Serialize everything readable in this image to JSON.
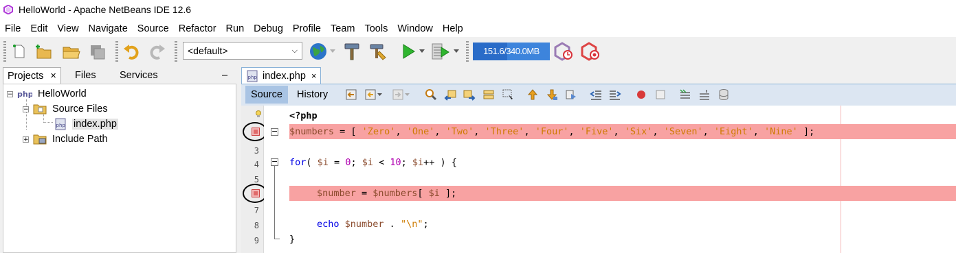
{
  "window": {
    "title": "HelloWorld - Apache NetBeans IDE 12.6"
  },
  "menu": [
    "File",
    "Edit",
    "View",
    "Navigate",
    "Source",
    "Refactor",
    "Run",
    "Debug",
    "Profile",
    "Team",
    "Tools",
    "Window",
    "Help"
  ],
  "toolbar": {
    "config_value": "<default>",
    "memory_label": "151.6/340.0MB",
    "memory_used_fraction": 0.446
  },
  "left_panel": {
    "tabs": [
      "Projects",
      "Files",
      "Services"
    ],
    "tab_close": "×",
    "minimize": "–",
    "tree": {
      "project": "HelloWorld",
      "source_files": "Source Files",
      "file": "index.php",
      "include_path": "Include Path"
    }
  },
  "editor": {
    "tab_label": "index.php",
    "tab_close": "×",
    "source_button": "Source",
    "history_button": "History",
    "line_numbers": [
      "3",
      "4",
      "5",
      "7",
      "8",
      "9"
    ],
    "code": {
      "l1_tag": "<?php",
      "l2_var": "$numbers",
      "l2_eq": " = [ ",
      "l2_items": [
        "'Zero'",
        "'One'",
        "'Two'",
        "'Three'",
        "'Four'",
        "'Five'",
        "'Six'",
        "'Seven'",
        "'Eight'",
        "'Nine'"
      ],
      "l2_end": " ];",
      "l4_for": "for",
      "l4_a": "( ",
      "l4_i1": "$i",
      "l4_b": " = ",
      "l4_zero": "0",
      "l4_c": "; ",
      "l4_i2": "$i",
      "l4_d": " < ",
      "l4_ten": "10",
      "l4_e": "; ",
      "l4_i3": "$i",
      "l4_f": "++ ) {",
      "l6_var1": "$number",
      "l6_eq": " = ",
      "l6_var2": "$numbers",
      "l6_br": "[ ",
      "l6_i": "$i",
      "l6_end": " ];",
      "l8_echo": "echo",
      "l8_var": " $number",
      "l8_dot": " . ",
      "l8_str": "\"\\n\"",
      "l8_end": ";",
      "l9_close": "}"
    }
  }
}
